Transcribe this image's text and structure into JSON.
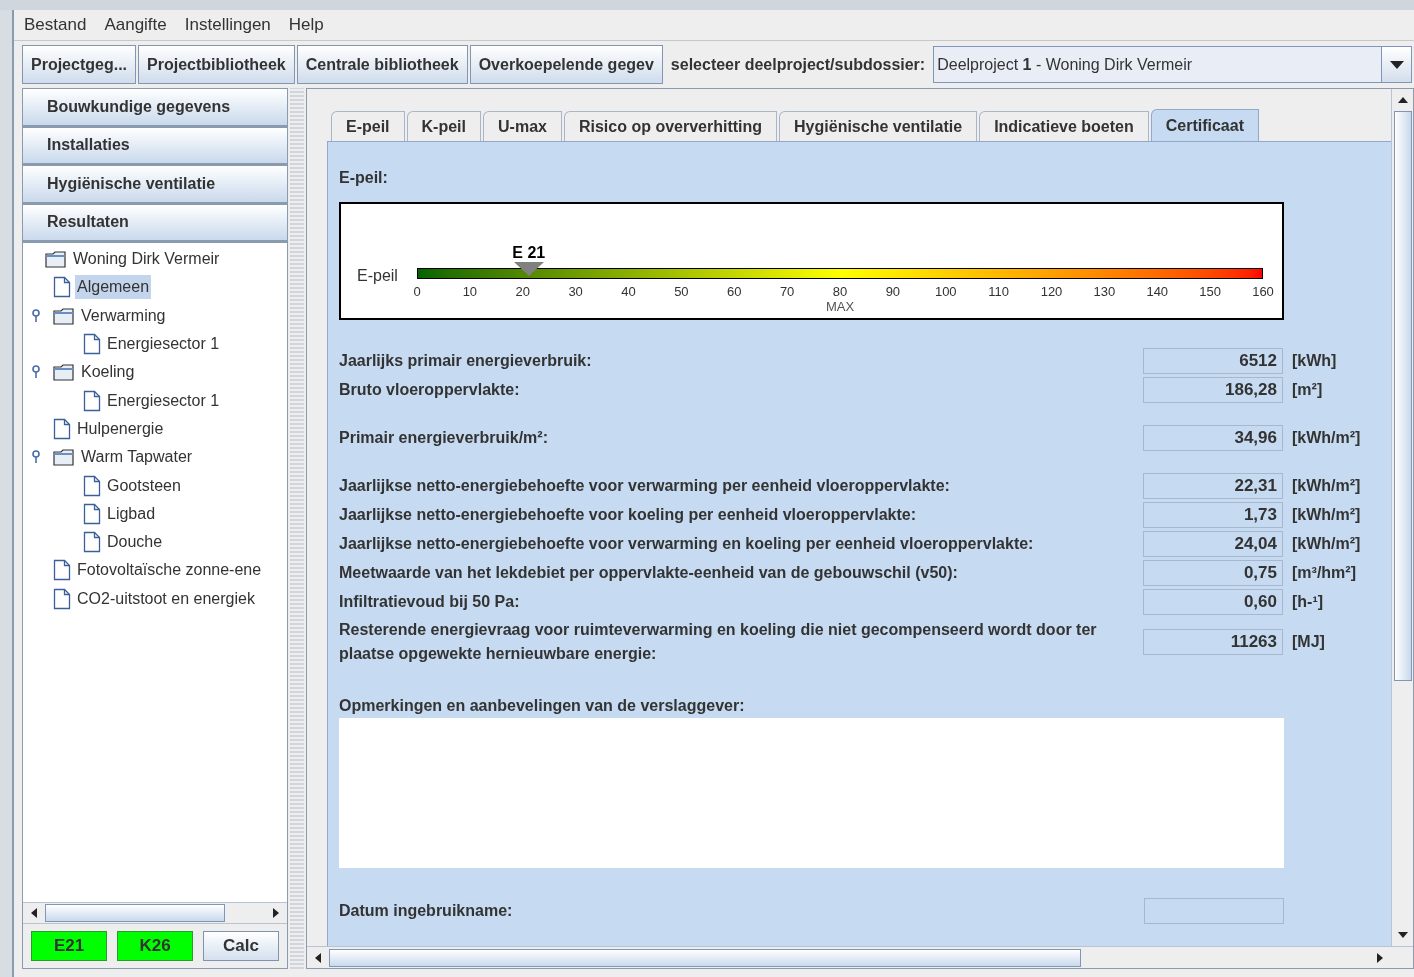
{
  "menu": [
    "Bestand",
    "Aangifte",
    "Instellingen",
    "Help"
  ],
  "toolbar": {
    "buttons": [
      "Projectgeg...",
      "Projectbibliotheek",
      "Centrale bibliotheek",
      "Overkoepelende gegev"
    ],
    "select_label": "selecteer deelproject/subdossier:",
    "select_value": "Deelproject **1** - Woning Dirk Vermeir"
  },
  "sidebar": {
    "sections": [
      "Bouwkundige gegevens",
      "Installaties",
      "Hygiënische ventilatie",
      "Resultaten"
    ],
    "tree": [
      {
        "label": "Woning Dirk Vermeir",
        "kind": "folder",
        "selected": false,
        "children": [
          {
            "label": "Algemeen",
            "kind": "page",
            "selected": true
          },
          {
            "label": "Verwarming",
            "kind": "folder",
            "selected": false,
            "children": [
              {
                "label": "Energiesector 1",
                "kind": "page",
                "selected": false
              }
            ]
          },
          {
            "label": "Koeling",
            "kind": "folder",
            "selected": false,
            "children": [
              {
                "label": "Energiesector 1",
                "kind": "page",
                "selected": false
              }
            ]
          },
          {
            "label": "Hulpenergie",
            "kind": "page",
            "selected": false
          },
          {
            "label": "Warm Tapwater",
            "kind": "folder",
            "selected": false,
            "children": [
              {
                "label": "Gootsteen",
                "kind": "page",
                "selected": false
              },
              {
                "label": "Ligbad",
                "kind": "page",
                "selected": false
              },
              {
                "label": "Douche",
                "kind": "page",
                "selected": false
              }
            ]
          },
          {
            "label": "Fotovoltaïsche zonne-ene",
            "kind": "page",
            "selected": false
          },
          {
            "label": "CO2-uitstoot en energiek",
            "kind": "page",
            "selected": false
          }
        ]
      }
    ],
    "buttons": [
      {
        "label": "E21",
        "color": "#00ff00"
      },
      {
        "label": "K26",
        "color": "#00ff00"
      },
      {
        "label": "Calc"
      }
    ]
  },
  "tabs": [
    {
      "label": "E-peil",
      "selected": false
    },
    {
      "label": "K-peil",
      "selected": false
    },
    {
      "label": "U-max",
      "selected": false
    },
    {
      "label": "Risico op oververhitting",
      "selected": false
    },
    {
      "label": "Hygiënische ventilatie",
      "selected": false
    },
    {
      "label": "Indicatieve boeten",
      "selected": false
    },
    {
      "label": "Certificaat",
      "selected": true
    }
  ],
  "epeil": {
    "title": "E-peil:",
    "scale_label": "E-peil",
    "marker": "E 21",
    "level": 0.13125,
    "ticks": [
      {
        "label": "0"
      },
      {
        "label": "10"
      },
      {
        "label": "20"
      },
      {
        "label": "30"
      },
      {
        "label": "40"
      },
      {
        "label": "50"
      },
      {
        "label": "60"
      },
      {
        "label": "70"
      },
      {
        "label": "80",
        "note": "MAX"
      },
      {
        "label": "90"
      },
      {
        "label": "100"
      },
      {
        "label": "110"
      },
      {
        "label": "120"
      },
      {
        "label": "130"
      },
      {
        "label": "140"
      },
      {
        "label": "150"
      },
      {
        "label": "160"
      }
    ]
  },
  "groups": [
    [
      {
        "label": "Jaarlijks primair energieverbruik:",
        "value": "6512",
        "unit": "[kWh]"
      },
      {
        "label": "Bruto vloeroppervlakte:",
        "value": "186,28",
        "unit": "[m²]"
      }
    ],
    [
      {
        "label": "Primair energieverbruik/m²:",
        "value": "34,96",
        "unit": "[kWh/m²]"
      }
    ],
    [
      {
        "label": "Jaarlijkse netto-energiebehoefte voor verwarming per eenheid vloeroppervlakte:",
        "value": "22,31",
        "unit": "[kWh/m²]"
      },
      {
        "label": "Jaarlijkse netto-energiebehoefte voor koeling per eenheid vloeroppervlakte:",
        "value": "1,73",
        "unit": "[kWh/m²]"
      },
      {
        "label": "Jaarlijkse netto-energiebehoefte voor verwarming en koeling per eenheid vloeroppervlakte:",
        "value": "24,04",
        "unit": "[kWh/m²]"
      },
      {
        "label": "Meetwaarde van het lekdebiet per oppervlakte-eenheid van de gebouwschil (v50):",
        "value": "0,75",
        "unit": "[m³/hm²]"
      },
      {
        "label": "Infiltratievoud bij 50 Pa:",
        "value": "0,60",
        "unit": "[h-¹]"
      },
      {
        "label": "Resterende energievraag voor ruimteverwarming en koeling die niet gecompenseerd wordt door ter plaatse opgewekte hernieuwbare energie:",
        "value": "11263",
        "unit": "[MJ]"
      }
    ]
  ],
  "remarks_label": "Opmerkingen en aanbevelingen van de verslaggever:",
  "date_label": "Datum ingebruikname:"
}
